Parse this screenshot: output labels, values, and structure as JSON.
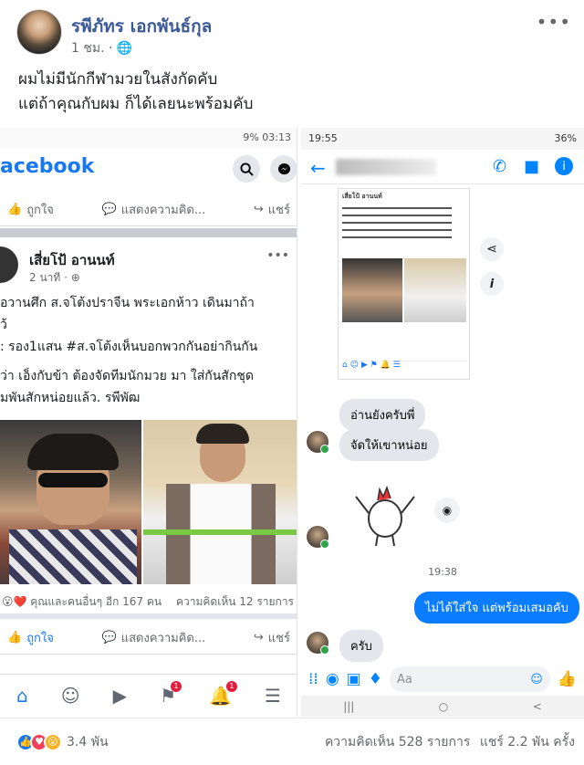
{
  "post": {
    "author": "รพีภัทร เอกพันธ์กุล",
    "time": "1 ชม. ·",
    "more_icon": "•••",
    "text_line1": "ผมไม่มีนักกีฬามวยในสังกัดคับ",
    "text_line2": "แต่ถ้าคุณกับผม ก็ได้เลยนะพร้อมคับ"
  },
  "left_screenshot": {
    "status": "9% 03:13",
    "logo": "acebook",
    "actions": {
      "like": "ถูกใจ",
      "comment": "แสดงความคิด...",
      "share": "แชร์"
    },
    "post_author": "เสี่ยโป้ อานนท์",
    "post_meta": "2 นาที · ",
    "post_lines": [
      "อวานศึก ส.จโต้งปราจีน พระเอกห้าว เดินมาถ้า",
      "ว้",
      ": รอง1แสน  #ส.จโต้งเห็นบอกพวกกันอย่ากินกัน",
      "ว่า เอ็งกับข้า   ต้องจัดทีมนักมวย มา ใส่กันสักชุด",
      "มพันสักหน่อยแล้ว. รพีพัฒ"
    ],
    "reactions_text": "คุณและคนอื่นๆ อีก 167 คน",
    "comments_text": "ความคิดเห็น 12 รายการ",
    "nav_badges": [
      "1",
      "1"
    ]
  },
  "right_screenshot": {
    "status_time": "19:55",
    "status_right": "36%",
    "mini_post_author": "เสี่ยโป้ อานนท์",
    "messages": {
      "m1": "อ่านยังครับพี่",
      "m2": "จัดให้เขาหน่อย",
      "timestamp": "19:38",
      "m3": "ไม่ได้ใส่ใจ แต่พร้อมเสมอคับ",
      "m4": "ครับ"
    },
    "input_placeholder": "Aa"
  },
  "footer": {
    "reactions_count": "3.4 พัน",
    "comments": "ความคิดเห็น 528 รายการ",
    "shares": "แชร์ 2.2 พัน ครั้ง"
  },
  "colors": {
    "fb_blue": "#1877f2",
    "messenger_blue": "#0a7cff",
    "author_blue": "#3b5998"
  }
}
